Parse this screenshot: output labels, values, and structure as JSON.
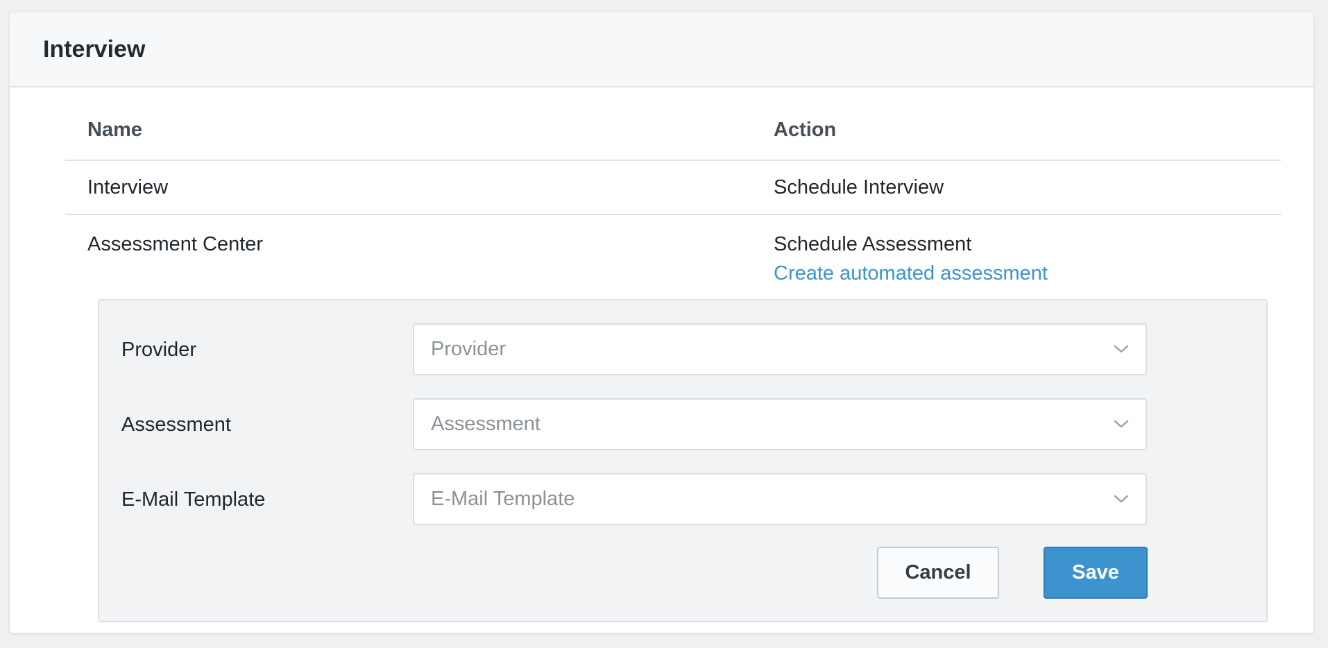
{
  "card": {
    "title": "Interview"
  },
  "table": {
    "headers": {
      "name": "Name",
      "action": "Action"
    },
    "rows": [
      {
        "name": "Interview",
        "action": "Schedule Interview"
      },
      {
        "name": "Assessment Center",
        "action": "Schedule Assessment",
        "link": "Create automated assessment"
      }
    ]
  },
  "form": {
    "provider": {
      "label": "Provider",
      "placeholder": "Provider"
    },
    "assessment": {
      "label": "Assessment",
      "placeholder": "Assessment"
    },
    "email_template": {
      "label": "E-Mail Template",
      "placeholder": "E-Mail Template"
    },
    "cancel_label": "Cancel",
    "save_label": "Save"
  },
  "colors": {
    "accent": "#3d93cd",
    "link": "#3a95cc",
    "panel_bg": "#f1f3f5",
    "page_bg": "#eff0f2"
  },
  "icons": {
    "select_arrow": "chevron-down-icon"
  }
}
